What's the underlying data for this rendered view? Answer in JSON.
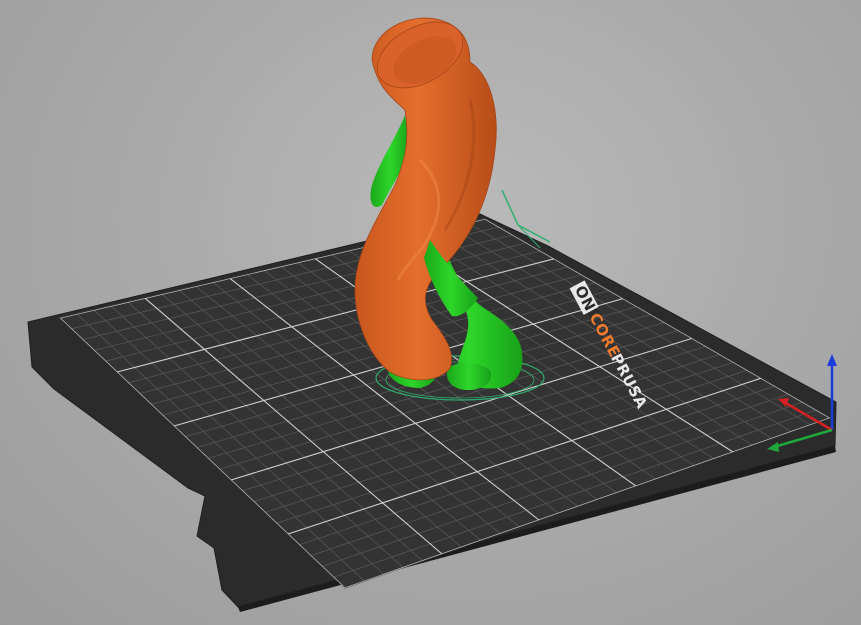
{
  "bed": {
    "brand_word": "PRUSA",
    "core_word": "CORE",
    "model_word": "ONE",
    "brand_color": "#e8e8e8",
    "accent_color": "#ef7a2c"
  },
  "colors": {
    "background": "#a8a8a8",
    "bed_surface": "#2e2e2e",
    "grid_line": "#5a5a5a",
    "grid_major": "#d8d8d8",
    "model": "#e0692a",
    "supports": "#22c21e",
    "axis_x": "#d42020",
    "axis_y": "#1fa83a",
    "axis_z": "#1a3cd8"
  },
  "icons": {
    "axis_gizmo": "xyz-axes-icon",
    "view_gizmo": "view-orientation-icon"
  }
}
